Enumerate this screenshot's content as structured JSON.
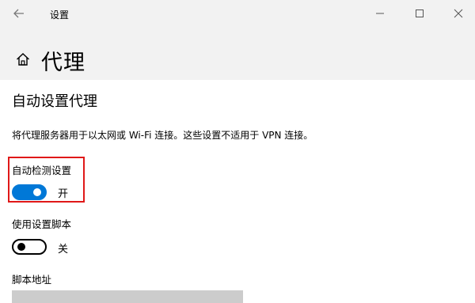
{
  "window": {
    "title": "设置",
    "back_icon": "arrow-left-icon",
    "minimize_icon": "minimize-icon",
    "maximize_icon": "maximize-icon",
    "close_icon": "close-icon"
  },
  "header": {
    "home_icon": "home-icon",
    "title": "代理"
  },
  "section": {
    "title": "自动设置代理",
    "description": "将代理服务器用于以太网或 Wi-Fi 连接。这些设置不适用于 VPN 连接。"
  },
  "settings": [
    {
      "label": "自动检测设置",
      "state": "开",
      "on": true
    },
    {
      "label": "使用设置脚本",
      "state": "关",
      "on": false
    }
  ],
  "script_address": {
    "label": "脚本地址",
    "value": ""
  },
  "colors": {
    "accent": "#0078d7",
    "highlight": "#e01818",
    "chrome": "#f2f2f2"
  }
}
